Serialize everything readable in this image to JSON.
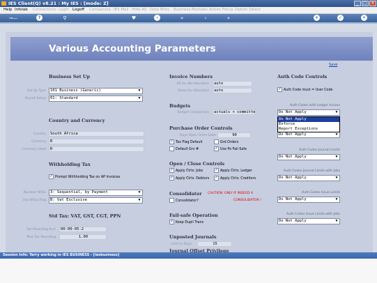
{
  "window": {
    "title": "IES Client(Q) v8.21 : My IES :        [mode: Z]",
    "buttons": [
      "_",
      "□",
      "✕"
    ]
  },
  "menu": [
    {
      "label": "Help",
      "enabled": true
    },
    {
      "label": "Infolab",
      "enabled": true
    },
    {
      "label": "Connections",
      "enabled": false
    },
    {
      "label": "Login",
      "enabled": false
    },
    {
      "label": "Logoff",
      "enabled": true
    },
    {
      "label": "Companies",
      "enabled": false
    },
    {
      "label": "IES Mail",
      "enabled": false
    },
    {
      "label": "Hide All",
      "enabled": false
    },
    {
      "label": "Data Mnts",
      "enabled": false
    },
    {
      "label": "Business Modules",
      "enabled": false
    },
    {
      "label": "Action Focus",
      "enabled": false
    },
    {
      "label": "Option Select",
      "enabled": false
    }
  ],
  "toolbar": {
    "icons": [
      "key-icon",
      "help-icon",
      "search-icon",
      "heart-icon",
      "back-icon",
      "rewind-icon",
      "forward-icon",
      "fast-forward-icon",
      "add-icon",
      "confirm-icon",
      "close-icon"
    ]
  },
  "header": {
    "title": "Various Accounting Parameters",
    "save_link": "Save"
  },
  "business_setup": {
    "title": "Business Set Up",
    "set_up_type_label": "Set Up Type",
    "set_up_type_value": "101 Business (Generic)",
    "payroll_setup_label": "Payroll Setup",
    "payroll_setup_value": "01: Standard"
  },
  "country_currency": {
    "title": "Country and Currency",
    "country_label": "Country",
    "country_value": "South Africa",
    "currency_label": "Currency",
    "currency_value": "R",
    "currency_label_label": "Currency Label",
    "currency_label_value": "R"
  },
  "withholding": {
    "title": "Withholding Tax",
    "prompt_label": "Prompt Withholding Tax on AP Invoices",
    "prompt_checked": true,
    "number_wtax_label": "Number WTax",
    "number_wtax_value": "3: Sequential, by Payment",
    "use_wtax_label": "Use WTax Flag",
    "use_wtax_value": "B: Vat Exclusive"
  },
  "std_tax": {
    "title": "Std Tax: VAT, GST, CGT, PPN",
    "tax_rounding_acct_label": "Tax Rounding Acct",
    "tax_rounding_acct_value": "00-00-05-2",
    "max_tax_rounding_label": "Max Tax Rounding",
    "max_tax_rounding_value": "1.00"
  },
  "invoice_numbers": {
    "title": "Invoice Numbers",
    "ar_label": "AR Inv No Allocation",
    "ar_value": "auto",
    "sales_label": "Sales Inv Allocation",
    "sales_value": "auto"
  },
  "budgets": {
    "title": "Budgets",
    "comparison_label": "Budget Comparison",
    "comparison_value": "actuals + committe"
  },
  "purchase_orders": {
    "title": "Purchase Order Controls",
    "days_label": "Days Open Order Date",
    "days_value": "90",
    "tax_flag_default": {
      "label": "Tax Flag Default",
      "checked": true
    },
    "grid_orders": {
      "label": "Grd Orders",
      "checked": false
    },
    "default_grv": {
      "label": "Default Grv #",
      "checked": false
    },
    "use_po_fail_safe": {
      "label": "Use Po Fail-Safe",
      "checked": true
    }
  },
  "open_close": {
    "title": "Open / Close Controls",
    "apply_ctrls_jobs": {
      "label": "Apply Ctrls: Jobs",
      "checked": true
    },
    "apply_ctrls_ledger": {
      "label": "Apply Ctrls: Ledger",
      "checked": true
    },
    "apply_ctrls_debtors": {
      "label": "Apply Ctrls: Debtors",
      "checked": true
    },
    "apply_ctrls_creditors": {
      "label": "Apply Ctrls: Creditors",
      "checked": true
    }
  },
  "consolidator": {
    "title": "Consolidator",
    "checkbox_label": "Consolidator?",
    "checked": false,
    "caution": "CAUTION: ONLY IF INDEED A",
    "caution2": "CONSOLIDATOR !"
  },
  "fail_safe": {
    "title": "Fail-safe Operation",
    "keep_dupli_label": "Keep Dupli Trans",
    "checked": true
  },
  "unposted": {
    "title": "Unposted Journals",
    "limit_label": "Limit in Days",
    "limit_value": "15"
  },
  "journal_offset": {
    "title": "Journal Offset Privilege"
  },
  "auth_codes": {
    "title": "Auth Code Controls",
    "must_user_code": {
      "label": "Auth Code must = User Code",
      "checked": true
    },
    "ledger_access_label": "Auth Codes with Ledger Access",
    "ledger_access_value": "Do Not Apply",
    "dropdown_options": [
      "Do Not Apply",
      "Enforce",
      "Report Exceptions"
    ],
    "dropdown_selected": "Do Not Apply",
    "behind_value": "Do Not Apply",
    "journal_limits_label": "Auth Codes Journal Limits",
    "journal_limits_value": "Do Not Apply",
    "journal_limits_jobs_label": "Auth Codes Journal Limits with Jobs",
    "journal_limits_jobs_value": "Do Not Apply",
    "issue_limits_label": "Auth Codes Issue Limits",
    "issue_limits_value": "Do Not Apply",
    "issue_limits_jobs_label": "Auth Codes Issue Limits with Jobs",
    "issue_limits_jobs_value": "Do Not Apply"
  },
  "status": {
    "text": "Session Info: Terry working in IES BUSINESS - [iesbusiness]"
  }
}
